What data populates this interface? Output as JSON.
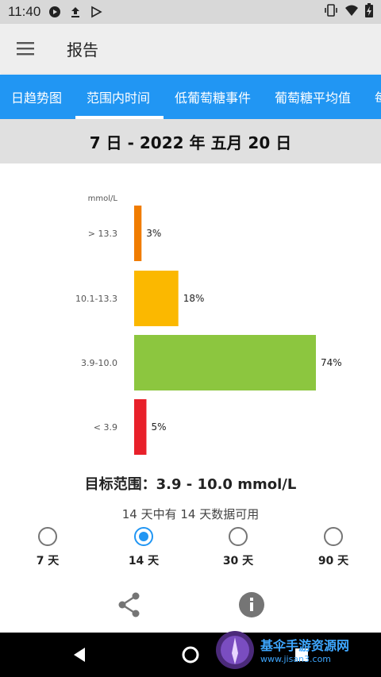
{
  "status_bar": {
    "time": "11:40",
    "left_icons": [
      "play-circle-icon",
      "upload-icon",
      "play-store-icon"
    ],
    "right_icons": [
      "vibrate-icon",
      "wifi-icon",
      "battery-charging-icon"
    ]
  },
  "app_bar": {
    "title": "报告",
    "menu_icon": "hamburger-menu-icon"
  },
  "tabs": [
    {
      "label": "日趋势图",
      "active": false
    },
    {
      "label": "范围内时间",
      "active": true
    },
    {
      "label": "低葡萄糖事件",
      "active": false
    },
    {
      "label": "葡萄糖平均值",
      "active": false
    },
    {
      "label": "每",
      "active": false
    }
  ],
  "date_range": "7 日 - 2022 年 五月 20 日",
  "chart_data": {
    "type": "bar",
    "orientation": "horizontal",
    "unit_label": "mmol/L",
    "categories": [
      "> 13.3",
      "10.1-13.3",
      "3.9-10.0",
      "< 3.9"
    ],
    "values": [
      3,
      18,
      74,
      5
    ],
    "value_labels": [
      "3%",
      "18%",
      "74%",
      "5%"
    ],
    "colors": [
      "#f07c00",
      "#fbb800",
      "#8cc63f",
      "#e8202a"
    ]
  },
  "target_range": "目标范围：3.9 - 10.0 mmol/L",
  "data_availability": "14 天中有 14 天数据可用",
  "period_options": [
    {
      "label": "7 天",
      "selected": false
    },
    {
      "label": "14 天",
      "selected": true
    },
    {
      "label": "30 天",
      "selected": false
    },
    {
      "label": "90 天",
      "selected": false
    }
  ],
  "actions": {
    "share_icon": "share-icon",
    "info_icon": "info-icon"
  },
  "nav": {
    "back_icon": "back-triangle-icon",
    "home_icon": "home-circle-icon",
    "recents_icon": "recents-square-icon"
  },
  "watermark": {
    "title": "基伞手游资源网",
    "subtitle": "www.jisan3.com"
  },
  "colors": {
    "accent": "#2196f3",
    "tab_bar": "#2196f3",
    "app_bar": "#eeeeee",
    "date_band": "#e0e0e0"
  }
}
